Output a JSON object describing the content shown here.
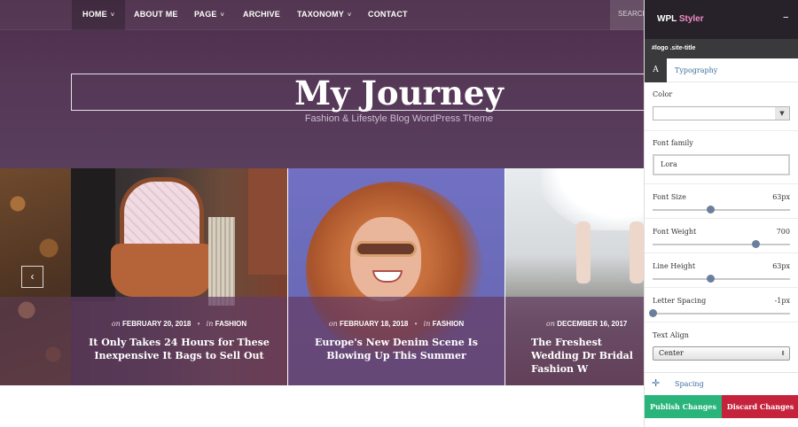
{
  "nav": {
    "items": [
      {
        "label": "HOME",
        "caret": "˅"
      },
      {
        "label": "ABOUT ME",
        "caret": ""
      },
      {
        "label": "PAGE",
        "caret": "˅"
      },
      {
        "label": "ARCHIVE",
        "caret": ""
      },
      {
        "label": "TAXONOMY",
        "caret": "˅"
      },
      {
        "label": "CONTACT",
        "caret": ""
      }
    ],
    "search_placeholder": "SEARCH"
  },
  "site": {
    "title": "My Journey",
    "tagline": "Fashion & Lifestyle Blog WordPress Theme"
  },
  "slider": {
    "prev_icon": "chevron-left-icon",
    "prev_glyph": "‹",
    "on_label": "on",
    "in_label": "in",
    "separator": "•",
    "slides": [
      {
        "date": "FEBRUARY 20, 2018",
        "category": "FASHION",
        "title": "It Only Takes 24 Hours for These Inexpensive It Bags to Sell Out"
      },
      {
        "date": "FEBRUARY 18, 2018",
        "category": "FASHION",
        "title": "Europe's New Denim Scene Is Blowing Up This Summer"
      },
      {
        "date": "DECEMBER 16, 2017",
        "category": "",
        "title": "The Freshest Wedding Dr Bridal Fashion W"
      }
    ]
  },
  "styler": {
    "brand_first": "WPL",
    "brand_second": "Styler",
    "minimize_glyph": "–",
    "selector": "#logo .site-title",
    "tab_icon_label": "A",
    "tab_label": "Typography",
    "color": {
      "label": "Color",
      "value": "",
      "drop_glyph": "▼"
    },
    "font_family": {
      "label": "Font family",
      "value": "Lora"
    },
    "font_size": {
      "label": "Font Size",
      "value": "63px",
      "level": 0.42
    },
    "font_weight": {
      "label": "Font Weight",
      "value": "700",
      "level": 0.75
    },
    "line_height": {
      "label": "Line Height",
      "value": "63px",
      "level": 0.42
    },
    "letter_spacing": {
      "label": "Letter Spacing",
      "value": "-1px",
      "level": 0.0
    },
    "text_align": {
      "label": "Text Align",
      "value": "Center",
      "arrow_glyph": "⇕"
    },
    "spacing": {
      "plus_glyph": "✛",
      "label": "Spacing"
    },
    "publish_label": "Publish Changes",
    "discard_label": "Discard Changes"
  },
  "colors": {
    "accent_pink": "#f28bc8",
    "publish_green": "#28b47a",
    "discard_red": "#c5223c"
  }
}
